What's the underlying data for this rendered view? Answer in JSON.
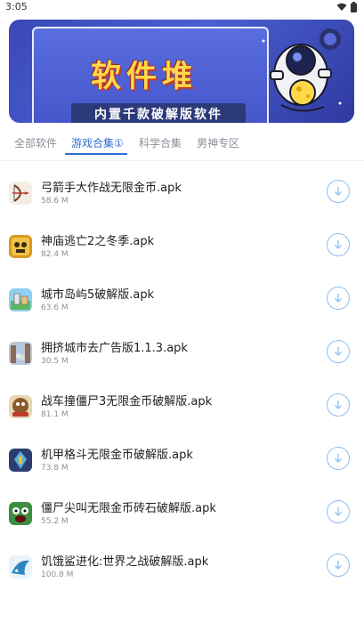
{
  "status": {
    "time": "3:05"
  },
  "banner": {
    "title": "软件堆",
    "subtitle": "内置千款破解版软件"
  },
  "tabs": [
    {
      "label": "全部软件"
    },
    {
      "label": "游戏合集①"
    },
    {
      "label": "科学合集"
    },
    {
      "label": "男神专区"
    }
  ],
  "apps": [
    {
      "name": "弓箭手大作战无限金币.apk",
      "size": "58.6 M"
    },
    {
      "name": "神庙逃亡2之冬季.apk",
      "size": "82.4 M"
    },
    {
      "name": "城市岛屿5破解版.apk",
      "size": "63.6 M"
    },
    {
      "name": "拥挤城市去广告版1.1.3.apk",
      "size": "30.5 M"
    },
    {
      "name": "战车撞僵尸3无限金币破解版.apk",
      "size": "81.1 M"
    },
    {
      "name": "机甲格斗无限金币破解版.apk",
      "size": "73.8 M"
    },
    {
      "name": "僵尸尖叫无限金币砖石破解版.apk",
      "size": "55.2 M"
    },
    {
      "name": "饥饿鲨进化:世界之战破解版.apk",
      "size": "100.8 M"
    }
  ],
  "colors": {
    "accent": "#2f6fd0",
    "download_ring": "#8ec0ef"
  }
}
